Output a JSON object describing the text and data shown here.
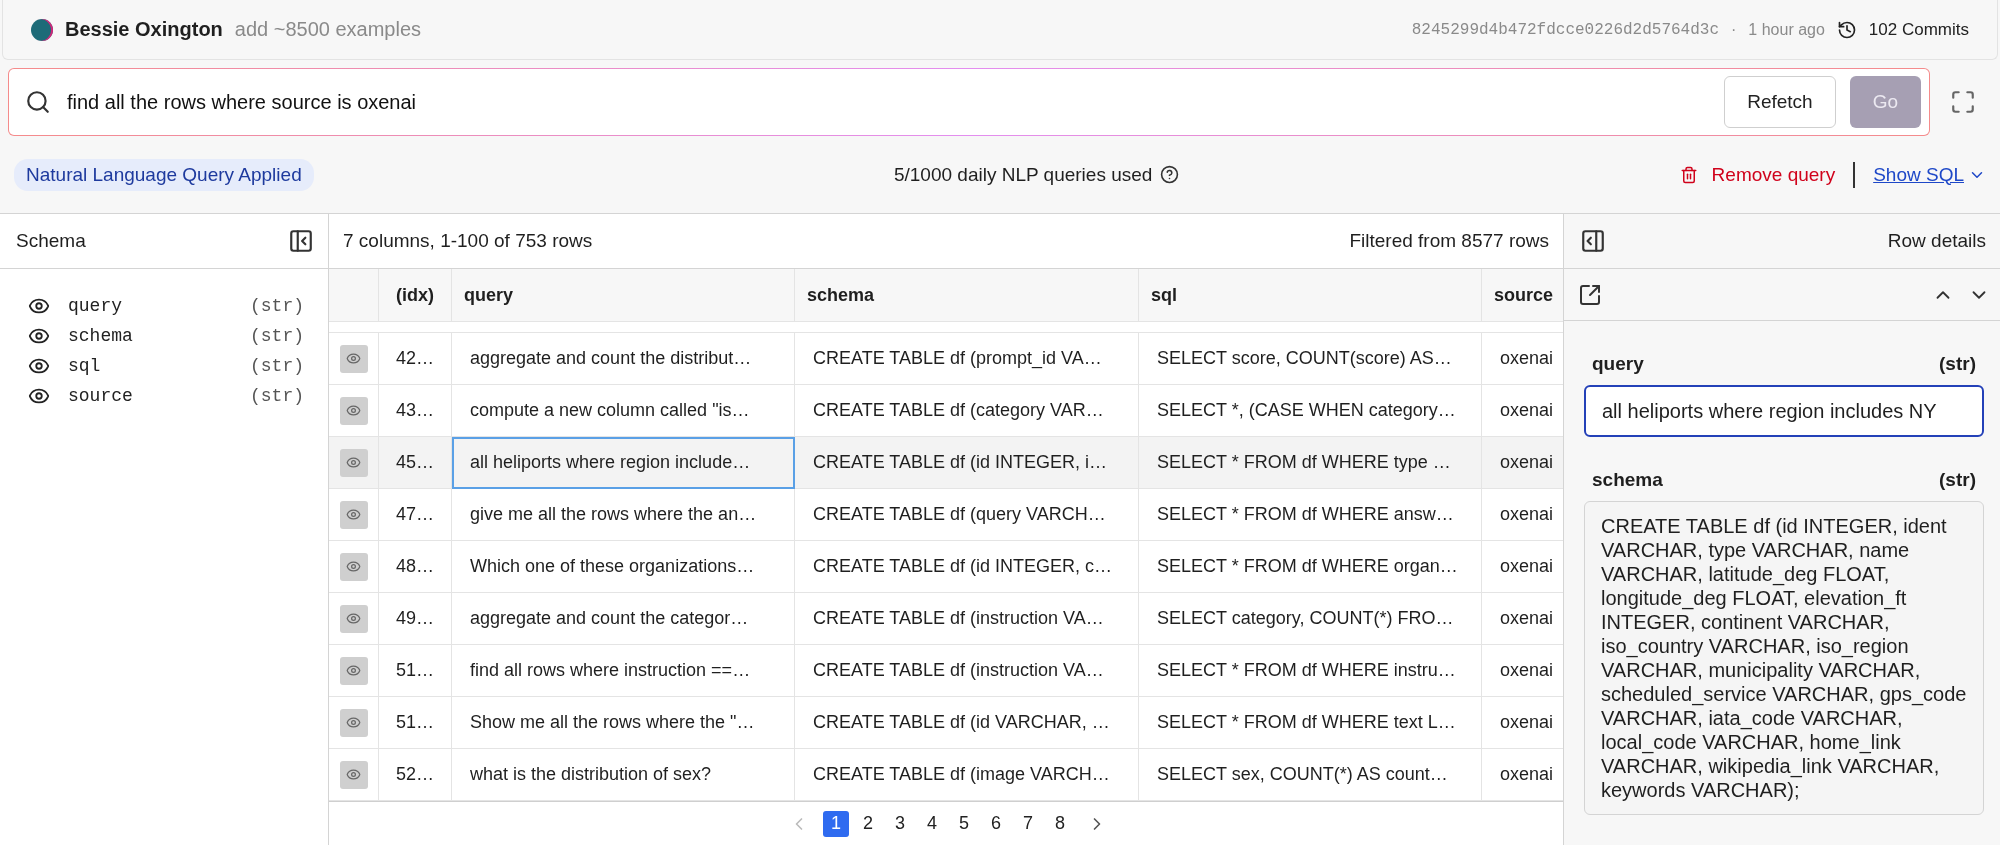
{
  "header": {
    "author": "Bessie Oxington",
    "message": "add ~8500 examples",
    "commit": "8245299d4b472fdcce0226d2d5764d3c",
    "separator": "·",
    "time": "1 hour ago",
    "commits": "102 Commits"
  },
  "search": {
    "value": "find all the rows where source is oxenai",
    "buttons": [
      {
        "label": "Refetch",
        "kind": "secondary"
      },
      {
        "label": "Go",
        "kind": "primary",
        "disabled": true
      }
    ]
  },
  "status": {
    "badge": "Natural Language Query Applied",
    "usage": "5/1000 daily NLP queries used",
    "remove": "Remove query",
    "show_sql": "Show SQL"
  },
  "schema_panel": {
    "title": "Schema",
    "fields": [
      {
        "name": "query",
        "type": "(str)"
      },
      {
        "name": "schema",
        "type": "(str)"
      },
      {
        "name": "sql",
        "type": "(str)"
      },
      {
        "name": "source",
        "type": "(str)"
      }
    ]
  },
  "table": {
    "summary": "7 columns, 1-100 of 753 rows",
    "filtered": "Filtered from 8577 rows",
    "columns": [
      "(idx)",
      "query",
      "schema",
      "sql",
      "source"
    ],
    "rows": [
      {
        "cells": [
          "42…",
          "aggregate and count the distribut…",
          "CREATE TABLE df (prompt_id VA…",
          "SELECT score, COUNT(score) AS…",
          "oxenai"
        ],
        "selected": false
      },
      {
        "cells": [
          "43…",
          "compute a new column called \"is…",
          "CREATE TABLE df (category VAR…",
          "SELECT *, (CASE WHEN category…",
          "oxenai"
        ],
        "selected": false
      },
      {
        "cells": [
          "45…",
          "all heliports where region include…",
          "CREATE TABLE df (id INTEGER, i…",
          "SELECT * FROM df WHERE type …",
          "oxenai"
        ],
        "selected": true
      },
      {
        "cells": [
          "47…",
          "give me all the rows where the an…",
          "CREATE TABLE df (query VARCH…",
          "SELECT * FROM df WHERE answ…",
          "oxenai"
        ],
        "selected": false
      },
      {
        "cells": [
          "48…",
          "Which one of these organizations…",
          "CREATE TABLE df (id INTEGER, c…",
          "SELECT * FROM df WHERE organ…",
          "oxenai"
        ],
        "selected": false
      },
      {
        "cells": [
          "49…",
          "aggregate and count the categor…",
          "CREATE TABLE df (instruction VA…",
          "SELECT category, COUNT(*) FRO…",
          "oxenai"
        ],
        "selected": false
      },
      {
        "cells": [
          "51…",
          "find all rows where instruction ==…",
          "CREATE TABLE df (instruction VA…",
          "SELECT * FROM df WHERE instru…",
          "oxenai"
        ],
        "selected": false
      },
      {
        "cells": [
          "51…",
          "Show me all the rows where the \"…",
          "CREATE TABLE df (id VARCHAR, …",
          "SELECT * FROM df WHERE text L…",
          "oxenai"
        ],
        "selected": false
      },
      {
        "cells": [
          "52…",
          "what is the distribution of sex?",
          "CREATE TABLE df (image VARCH…",
          "SELECT sex, COUNT(*) AS count…",
          "oxenai"
        ],
        "selected": false
      }
    ],
    "pages": [
      {
        "label": "1",
        "selected": true
      },
      {
        "label": "2",
        "selected": false
      },
      {
        "label": "3",
        "selected": false
      },
      {
        "label": "4",
        "selected": false
      },
      {
        "label": "5",
        "selected": false
      },
      {
        "label": "6",
        "selected": false
      },
      {
        "label": "7",
        "selected": false
      },
      {
        "label": "8",
        "selected": false
      }
    ]
  },
  "row_details": {
    "title": "Row details",
    "fields": [
      {
        "name": "query",
        "type": "(str)",
        "value": "all heliports where region includes NY",
        "focused": true
      },
      {
        "name": "schema",
        "type": "(str)",
        "value": "CREATE TABLE df (id INTEGER, ident VARCHAR, type VARCHAR, name VARCHAR, latitude_deg FLOAT, longitude_deg FLOAT, elevation_ft INTEGER, continent VARCHAR, iso_country VARCHAR, iso_region VARCHAR, municipality VARCHAR, scheduled_service VARCHAR, gps_code VARCHAR, iata_code VARCHAR, local_code VARCHAR, home_link VARCHAR, wikipedia_link VARCHAR, keywords VARCHAR);",
        "focused": false
      }
    ]
  }
}
